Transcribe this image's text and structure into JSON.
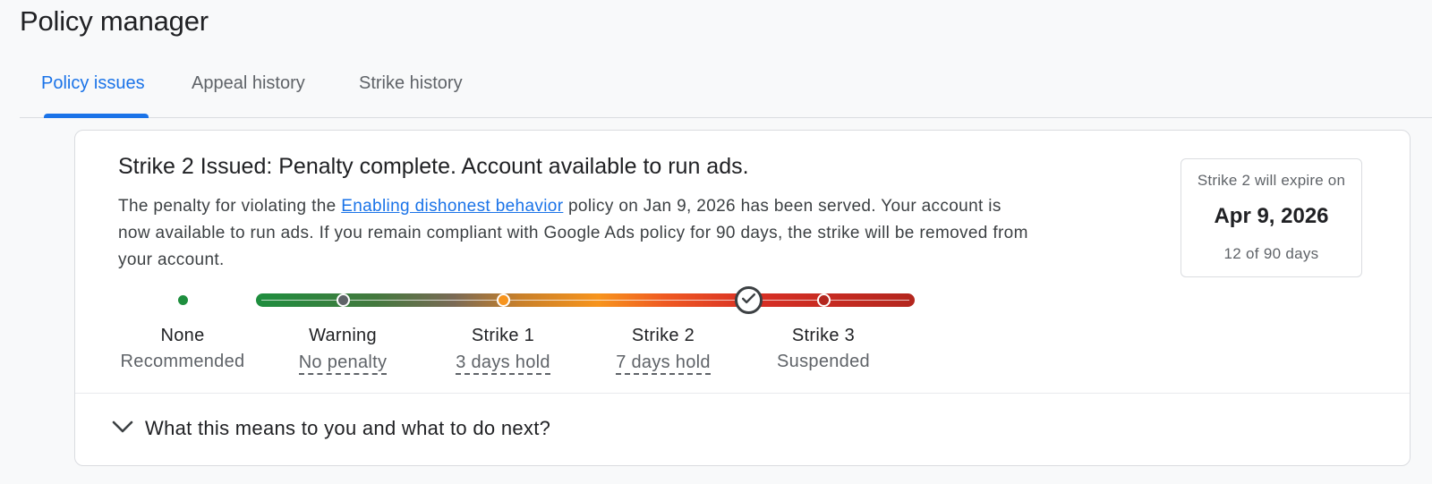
{
  "page_title": "Policy manager",
  "tabs": [
    {
      "label": "Policy issues",
      "active": true
    },
    {
      "label": "Appeal history",
      "active": false
    },
    {
      "label": "Strike history",
      "active": false
    }
  ],
  "card": {
    "headline": "Strike 2 Issued: Penalty complete. Account available to run ads.",
    "body_before_link": "The penalty for violating the ",
    "policy_link": "Enabling dishonest behavior",
    "body_after_link": " policy on Jan 9, 2026 has been served. Your account is now available to run ads. If you remain compliant with Google Ads policy for 90 days, the strike will be removed from your account.",
    "expiry": {
      "label": "Strike 2 will expire on",
      "date": "Apr 9, 2026",
      "progress": "12 of 90 days"
    },
    "stages": [
      {
        "name": "None",
        "detail": "Recommended",
        "color": "#1e8e3e"
      },
      {
        "name": "Warning",
        "detail": "No penalty",
        "color": "#5f6368"
      },
      {
        "name": "Strike 1",
        "detail": "3 days hold",
        "color": "#f7941d"
      },
      {
        "name": "Strike 2",
        "detail": "7 days hold",
        "color": "#3c4043"
      },
      {
        "name": "Strike 3",
        "detail": "Suspended",
        "color": "#b3261e"
      }
    ],
    "current_stage": "Strike 2",
    "expand_label": "What this means to you and what to do next?"
  },
  "icons": {
    "current": "check-icon",
    "expand": "chevron-down-icon"
  }
}
